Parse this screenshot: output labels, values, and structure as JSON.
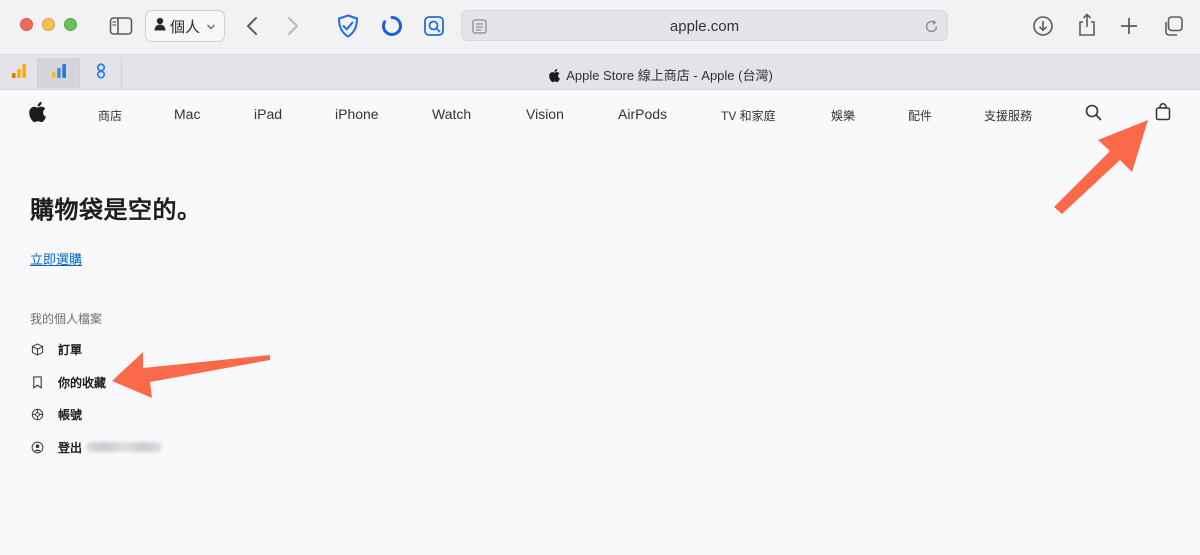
{
  "browser": {
    "profile_label": "個人",
    "address_url": "apple.com",
    "tab_title": "Apple Store 線上商店 - Apple (台灣)"
  },
  "nav": {
    "items": [
      "商店",
      "Mac",
      "iPad",
      "iPhone",
      "Watch",
      "Vision",
      "AirPods",
      "TV 和家庭",
      "娛樂",
      "配件",
      "支援服務"
    ]
  },
  "bag": {
    "title": "購物袋是空的。",
    "shop_link": "立即選購"
  },
  "profile": {
    "heading": "我的個人檔案",
    "items": [
      {
        "label": "訂單",
        "icon": "box-icon"
      },
      {
        "label": "你的收藏",
        "icon": "bookmark-icon"
      },
      {
        "label": "帳號",
        "icon": "gear-icon"
      },
      {
        "label": "登出",
        "icon": "person-circle-icon"
      }
    ]
  },
  "annotation_color": "#fa6a48"
}
